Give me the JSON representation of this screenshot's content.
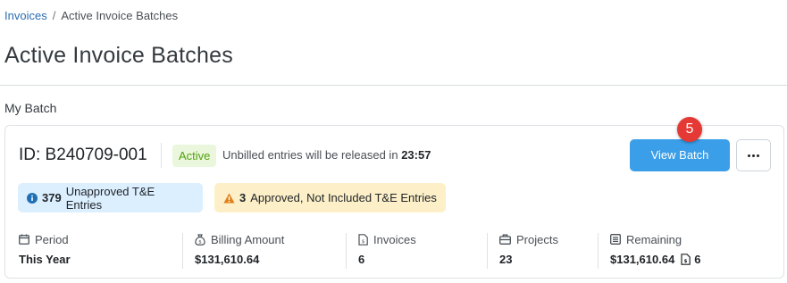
{
  "breadcrumb": {
    "items": [
      {
        "label": "Invoices"
      },
      {
        "label": "Active Invoice Batches"
      }
    ],
    "separator": "/"
  },
  "page": {
    "title": "Active Invoice Batches",
    "section_label": "My Batch"
  },
  "batch": {
    "id_text": "ID: B240709-001",
    "status": "Active",
    "release_prefix": "Unbilled entries will be released in",
    "release_time": "23:57",
    "view_button": "View Batch",
    "step_marker": "5",
    "alerts": {
      "unapproved_count": "379",
      "unapproved_label": "Unapproved T&E Entries",
      "approved_count": "3",
      "approved_label": "Approved, Not Included T&E Entries"
    },
    "stats": {
      "period": {
        "label": "Period",
        "value": "This Year"
      },
      "billing": {
        "label": "Billing Amount",
        "value": "$131,610.64"
      },
      "invoices": {
        "label": "Invoices",
        "value": "6"
      },
      "projects": {
        "label": "Projects",
        "value": "23"
      },
      "remaining": {
        "label": "Remaining",
        "value": "$131,610.64",
        "count": "6"
      }
    }
  },
  "colors": {
    "primary_button": "#3a9ee8",
    "active_badge_bg": "#eaf7dc",
    "active_badge_text": "#52a00e",
    "info_bg": "#dcefff",
    "warn_bg": "#fdf0c8",
    "step_marker": "#e53935"
  },
  "icons": {
    "info": "info-circle-icon",
    "warning": "warning-triangle-icon",
    "period": "calendar-icon",
    "billing": "money-bag-icon",
    "invoices": "invoice-document-icon",
    "projects": "briefcase-icon",
    "remaining": "ledger-icon",
    "more": "more-horizontal-icon"
  }
}
